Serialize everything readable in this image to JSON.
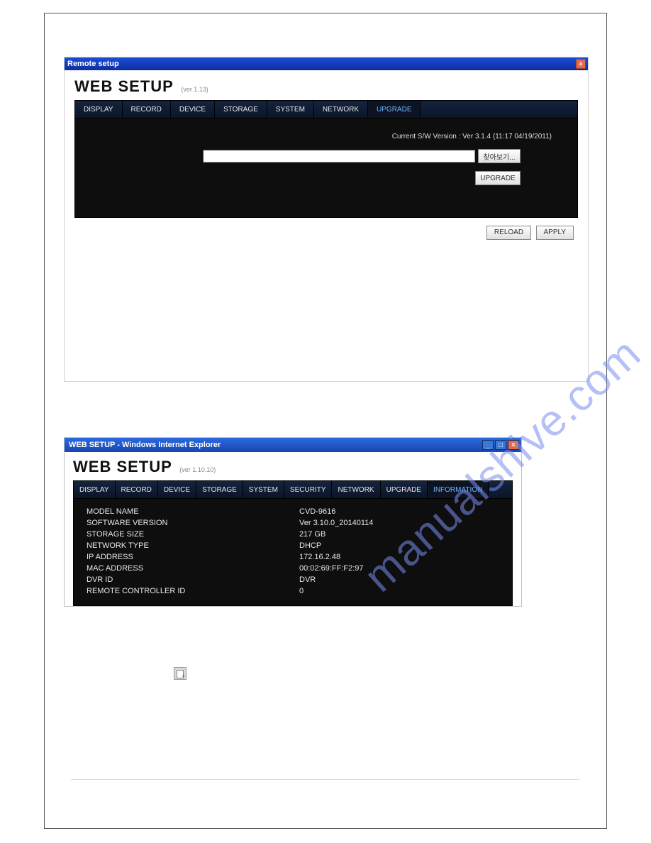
{
  "screenshot1": {
    "titlebar": "Remote setup",
    "heading": "WEB SETUP",
    "version": "(ver 1.13)",
    "tabs": [
      "DISPLAY",
      "RECORD",
      "DEVICE",
      "STORAGE",
      "SYSTEM",
      "NETWORK",
      "UPGRADE"
    ],
    "active_tab": 6,
    "sw_version_label": "Current S/W Version : Ver 3.1.4 (11:17 04/19/2011)",
    "browse_button": "찾아보기...",
    "upgrade_button": "UPGRADE",
    "reload_button": "RELOAD",
    "apply_button": "APPLY",
    "file_value": ""
  },
  "screenshot2": {
    "titlebar": "WEB SETUP - Windows Internet Explorer",
    "heading": "WEB SETUP",
    "version": "(ver 1.10.10)",
    "tabs": [
      "DISPLAY",
      "RECORD",
      "DEVICE",
      "STORAGE",
      "SYSTEM",
      "SECURITY",
      "NETWORK",
      "UPGRADE",
      "INFORMATION"
    ],
    "active_tab": 8,
    "info": [
      {
        "label": "MODEL NAME",
        "value": "CVD-9616"
      },
      {
        "label": "SOFTWARE VERSION",
        "value": "Ver 3.10.0_20140114"
      },
      {
        "label": "STORAGE SIZE",
        "value": "217 GB"
      },
      {
        "label": "NETWORK TYPE",
        "value": "DHCP"
      },
      {
        "label": "IP ADDRESS",
        "value": "172.16.2.48"
      },
      {
        "label": "MAC ADDRESS",
        "value": "00:02:69:FF:F2:97"
      },
      {
        "label": "DVR ID",
        "value": "DVR"
      },
      {
        "label": "REMOTE CONTROLLER ID",
        "value": "0"
      }
    ]
  },
  "watermark": "manualshive.com"
}
